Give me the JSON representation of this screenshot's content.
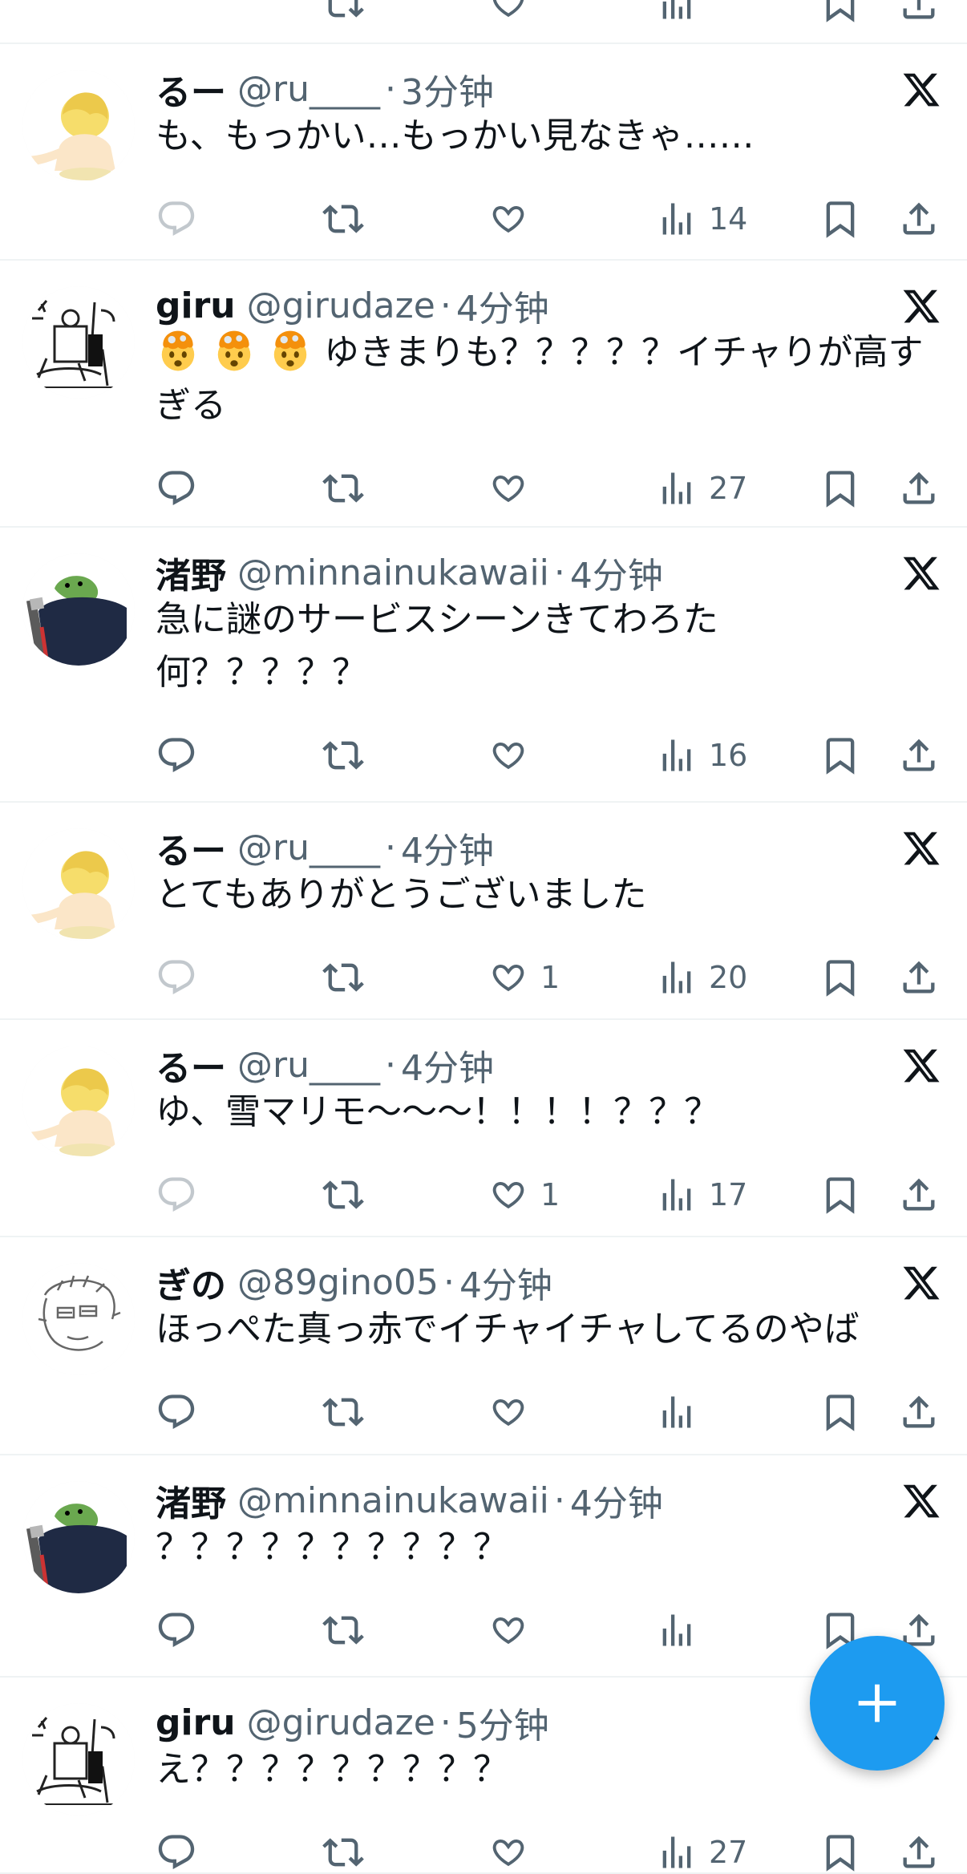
{
  "colors": {
    "accent": "#1d9bf0",
    "text_primary": "#0f1419",
    "text_secondary": "#536471",
    "divider": "#eff3f4"
  },
  "icons": {
    "reply": "reply-icon",
    "retweet": "retweet-icon",
    "like": "like-icon",
    "views": "views-icon",
    "bookmark": "bookmark-icon",
    "share": "share-icon",
    "source": "x-logo-icon",
    "compose": "compose-plus-icon"
  },
  "tweets": [
    {
      "name": "るー",
      "handle": "@ru____",
      "separator": "·",
      "time": "3分钟",
      "text": "も、もっかい…もっかい見なきゃ……",
      "stats": {
        "replies": "",
        "retweets": "",
        "likes": "",
        "views": "14"
      },
      "reply_disabled": true
    },
    {
      "name": "giru",
      "handle": "@girudaze",
      "separator": "·",
      "time": "4分钟",
      "text": "ゆきまりも？？？？？イチャりが高すぎる",
      "emoji_prefix": [
        "exploding-head-emoji",
        "exploding-head-emoji",
        "exploding-head-emoji"
      ],
      "stats": {
        "replies": "",
        "retweets": "",
        "likes": "",
        "views": "27"
      },
      "reply_disabled": false
    },
    {
      "name": "渚野",
      "handle": "@minnainukawaii",
      "separator": "·",
      "time": "4分钟",
      "text_line1": "急に謎のサービスシーンきてわろた",
      "text_line2": "何？？？？？",
      "stats": {
        "replies": "",
        "retweets": "",
        "likes": "",
        "views": "16"
      },
      "reply_disabled": false
    },
    {
      "name": "るー",
      "handle": "@ru____",
      "separator": "·",
      "time": "4分钟",
      "text": "とてもありがとうございました",
      "stats": {
        "replies": "",
        "retweets": "",
        "likes": "1",
        "views": "20"
      },
      "reply_disabled": true
    },
    {
      "name": "るー",
      "handle": "@ru____",
      "separator": "·",
      "time": "4分钟",
      "text": "ゆ、雪マリモ〜〜〜！！！！？？？",
      "stats": {
        "replies": "",
        "retweets": "",
        "likes": "1",
        "views": "17"
      },
      "reply_disabled": true
    },
    {
      "name": "ぎの",
      "handle": "@89gino05",
      "separator": "·",
      "time": "4分钟",
      "text": "ほっぺた真っ赤でイチャイチャしてるのやば",
      "stats": {
        "replies": "",
        "retweets": "",
        "likes": "",
        "views": ""
      },
      "reply_disabled": false
    },
    {
      "name": "渚野",
      "handle": "@minnainukawaii",
      "separator": "·",
      "time": "4分钟",
      "text": "？？？？？？？？？？",
      "stats": {
        "replies": "",
        "retweets": "",
        "likes": "",
        "views": ""
      },
      "reply_disabled": false
    },
    {
      "name": "giru",
      "handle": "@girudaze",
      "separator": "·",
      "time": "5分钟",
      "text": "え？？？？？？？？？",
      "stats": {
        "replies": "",
        "retweets": "",
        "likes": "",
        "views": "27"
      },
      "reply_disabled": false
    }
  ]
}
